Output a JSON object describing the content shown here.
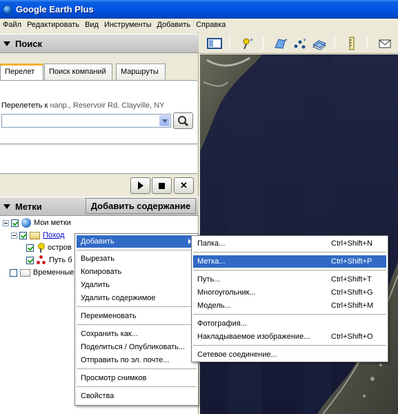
{
  "window": {
    "title": "Google Earth Plus"
  },
  "menubar": [
    "Файл",
    "Редактировать",
    "Вид",
    "Инструменты",
    "Добавить",
    "Справка"
  ],
  "search_panel": {
    "header": "Поиск",
    "tabs": [
      "Перелет",
      "Поиск компаний",
      "Маршруты"
    ],
    "fly_label": "Перелететь к",
    "fly_hint": "напр., Reservoir Rd. Clayville, NY",
    "input_value": ""
  },
  "places_panel": {
    "header": "Метки",
    "add_content_button": "Добавить содержание",
    "tree": {
      "my_places": "Мои метки",
      "hike": "Поход",
      "island": "остров",
      "path_item": "Путь б",
      "temporary": "Временные"
    }
  },
  "context_menu": {
    "items": [
      "Добавить",
      "Вырезать",
      "Копировать",
      "Удалить",
      "Удалить содержимое",
      "Переименовать",
      "Сохранить как...",
      "Поделиться / Опубликовать...",
      "Отправить по эл. почте...",
      "Просмотр снимков",
      "Свойства"
    ]
  },
  "submenu": {
    "items": [
      {
        "label": "Папка...",
        "shortcut": "Ctrl+Shift+N"
      },
      {
        "label": "Метка...",
        "shortcut": "Ctrl+Shift+P"
      },
      {
        "label": "Путь...",
        "shortcut": "Ctrl+Shift+T"
      },
      {
        "label": "Многоугольник...",
        "shortcut": "Ctrl+Shift+G"
      },
      {
        "label": "Модель...",
        "shortcut": "Ctrl+Shift+M"
      },
      {
        "label": "Фотография...",
        "shortcut": ""
      },
      {
        "label": "Накладываемое изображение...",
        "shortcut": "Ctrl+Shift+O"
      },
      {
        "label": "Сетевое соединение...",
        "shortcut": ""
      }
    ]
  },
  "colors": {
    "titlebar": "#0054e3",
    "highlight": "#316ac5",
    "chrome": "#ece9d8"
  }
}
